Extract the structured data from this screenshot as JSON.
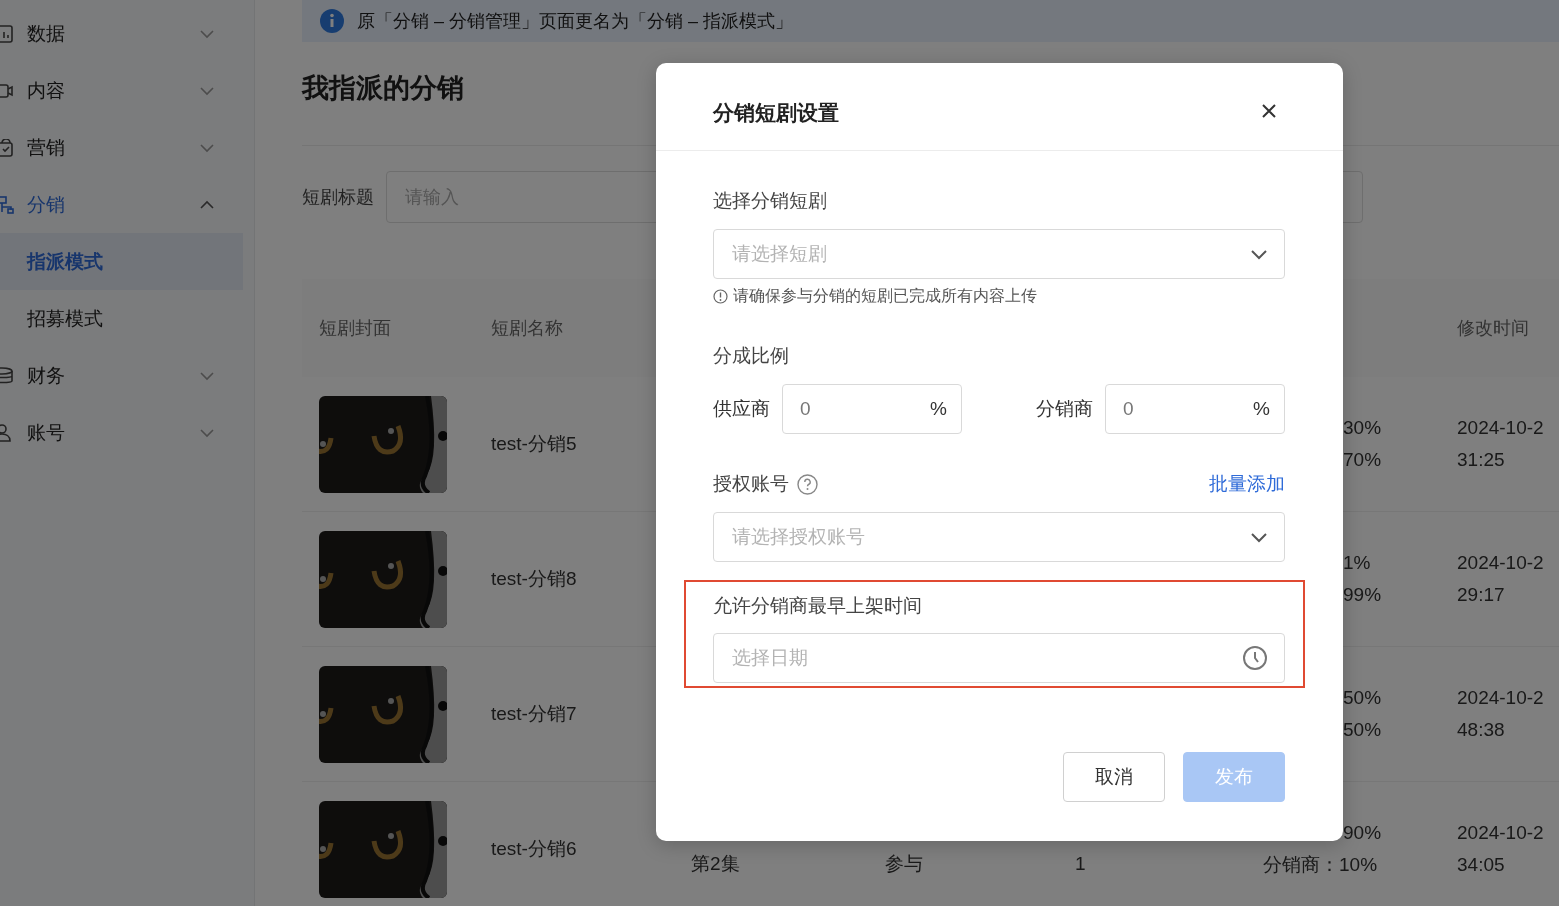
{
  "sidebar": {
    "items": [
      {
        "label": "数据",
        "expanded": false,
        "selected": false
      },
      {
        "label": "内容",
        "expanded": false,
        "selected": false
      },
      {
        "label": "营销",
        "expanded": false,
        "selected": false
      },
      {
        "label": "分销",
        "expanded": true,
        "selected": true,
        "children": [
          {
            "label": "指派模式",
            "selected": true
          },
          {
            "label": "招募模式",
            "selected": false
          }
        ]
      },
      {
        "label": "财务",
        "expanded": false,
        "selected": false
      },
      {
        "label": "账号",
        "expanded": false,
        "selected": false
      }
    ]
  },
  "notice": {
    "text": "原「分销 – 分销管理」页面更名为「分销 – 指派模式」"
  },
  "page_title": "我指派的分销",
  "filter": {
    "label": "短剧标题",
    "placeholder": "请输入"
  },
  "table": {
    "columns": [
      "短剧封面",
      "短剧名称",
      "修改时间"
    ],
    "rows": [
      {
        "cover": {
          "kind": "picture"
        },
        "name": "test-分销5",
        "ratio": [
          {
            "text": "30%",
            "kind": "cut"
          },
          {
            "text": "70%",
            "kind": "cut"
          }
        ],
        "time": [
          "2024-10-2",
          "31:25"
        ]
      },
      {
        "cover": {
          "kind": "picture"
        },
        "name": "test-分销8",
        "ratio": [
          {
            "text": "1%",
            "kind": "cut"
          },
          {
            "text": "99%",
            "kind": "cut"
          }
        ],
        "time": [
          "2024-10-2",
          "29:17"
        ]
      },
      {
        "cover": {
          "kind": "picture"
        },
        "name": "test-分销7",
        "ratio": [
          {
            "text": "50%",
            "kind": "cut"
          },
          {
            "text": "50%",
            "kind": "cut"
          }
        ],
        "time": [
          "2024-10-2",
          "48:38"
        ]
      },
      {
        "cover": {
          "kind": "picture"
        },
        "name": "test-分销6",
        "episode": "第2集",
        "status": "参与",
        "count": "1",
        "ratio": [
          {
            "text": "90%",
            "kind": "cut"
          },
          {
            "text": "分销商：10%",
            "kind": "full"
          }
        ],
        "time": [
          "2024-10-2",
          "34:05"
        ]
      }
    ]
  },
  "dialog": {
    "title": "分销短剧设置",
    "fields": [
      {
        "kind": "select",
        "label": "选择分销短剧",
        "placeholder": "请选择短剧",
        "hint": "请确保参与分销的短剧已完成所有内容上传"
      },
      {
        "kind": "ratio",
        "label": "分成比例",
        "inputs": [
          {
            "label": "供应商",
            "value": "0",
            "suffix": "%"
          },
          {
            "label": "分销商",
            "value": "0",
            "suffix": "%"
          }
        ]
      },
      {
        "kind": "select",
        "label": "授权账号",
        "help": true,
        "action": "批量添加",
        "placeholder": "请选择授权账号"
      },
      {
        "kind": "date",
        "label": "允许分销商最早上架时间",
        "placeholder": "选择日期",
        "highlighted": true
      }
    ],
    "buttons": [
      {
        "label": "取消",
        "kind": "secondary",
        "disabled": false
      },
      {
        "label": "发布",
        "kind": "primary",
        "disabled": true
      }
    ]
  }
}
